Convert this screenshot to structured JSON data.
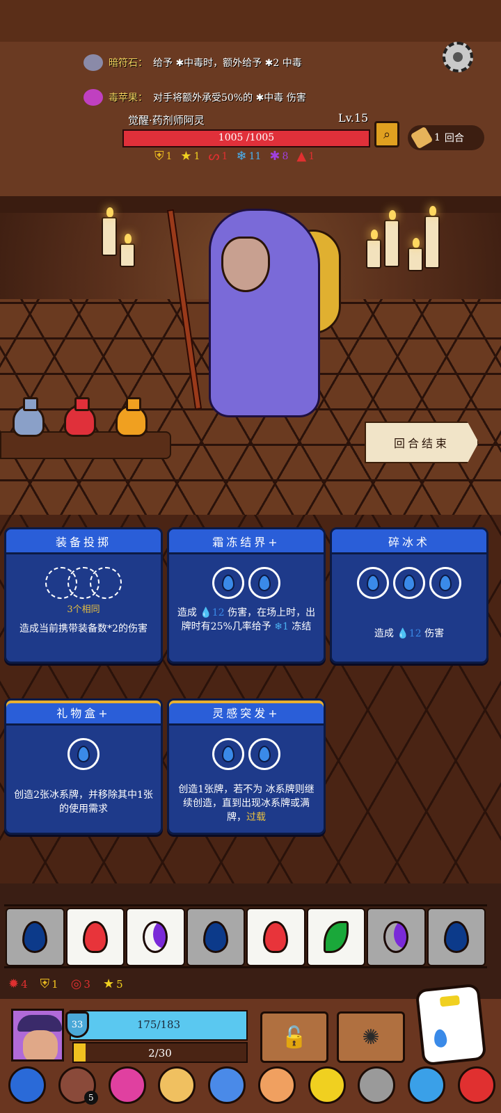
{
  "top_info": {
    "stone_name": "暗符石：",
    "stone_desc": "给予 ✱中毒时，额外给予 ✱2 中毒",
    "fruit_name": "毒苹果：",
    "fruit_desc": "对手将额外承受50%的 ✱中毒 伤害"
  },
  "enemy": {
    "name": "觉醒·药剂师阿灵",
    "level": "Lv.15",
    "hp_text": "1005 /1005",
    "hp_fraction": 1.0,
    "round_count": "1",
    "round_label": "回合",
    "statuses": [
      {
        "icon": "shield-icon",
        "glyph": "⛨",
        "color": "#f0c020",
        "value": "1"
      },
      {
        "icon": "star-icon",
        "glyph": "★",
        "color": "#f0d020",
        "value": "1"
      },
      {
        "icon": "curse-icon",
        "glyph": "ᔕ",
        "color": "#e03030",
        "value": "1"
      },
      {
        "icon": "frost-icon",
        "glyph": "❄",
        "color": "#4ab0f0",
        "value": "11"
      },
      {
        "icon": "poison-icon",
        "glyph": "✱",
        "color": "#a040e0",
        "value": "8"
      },
      {
        "icon": "flame-icon",
        "glyph": "▲",
        "color": "#e03030",
        "value": "1"
      }
    ]
  },
  "end_turn_label": "回合结束",
  "cards": [
    {
      "title": "装备投掷",
      "slot_note": "3个相同",
      "desc": "造成当前携带装备数*2的伤害"
    },
    {
      "title": "霜冻结界+",
      "desc_parts": [
        "造成 ",
        "12",
        " 伤害，在场上时，出牌时有25%几率给予 ",
        "❄1",
        " 冻结"
      ]
    },
    {
      "title": "碎冰术",
      "desc_parts": [
        "造成 ",
        "12",
        " 伤害"
      ]
    },
    {
      "title": "礼物盒+",
      "desc": "创造2张冰系牌，并移除其中1张的使用需求"
    },
    {
      "title": "灵感突发+",
      "desc_main": "创造1张牌，若不为 冰系牌则继续创造，直到出现冰系牌或满牌，",
      "desc_hl": "过载"
    }
  ],
  "dice_tray": [
    "water",
    "fire",
    "moon",
    "water",
    "fire",
    "leaf",
    "moon",
    "water"
  ],
  "player_statuses": [
    {
      "icon": "gear-burst-icon",
      "glyph": "✹",
      "color": "#e03030",
      "value": "4"
    },
    {
      "icon": "shield-icon",
      "glyph": "⛨",
      "color": "#f0c020",
      "value": "1"
    },
    {
      "icon": "spiral-icon",
      "glyph": "◎",
      "color": "#e03030",
      "value": "3"
    },
    {
      "icon": "star-icon",
      "glyph": "★",
      "color": "#f0d020",
      "value": "5"
    }
  ],
  "player": {
    "armor": "33",
    "hp_text": "175/183",
    "hp_fraction": 0.956,
    "exp_text": "2/30",
    "exp_fraction": 0.067
  },
  "relics": [
    {
      "name": "amulet-relic",
      "color": "#2a6ad8"
    },
    {
      "name": "button-relic",
      "color": "#8a4a3a",
      "count": "5"
    },
    {
      "name": "pink-blob-relic",
      "color": "#e040a0"
    },
    {
      "name": "cube-relic",
      "color": "#f0c060"
    },
    {
      "name": "blue-bird-relic",
      "color": "#4a8ae8"
    },
    {
      "name": "ring-relic",
      "color": "#f0a060"
    },
    {
      "name": "chain-relic",
      "color": "#f0d020"
    },
    {
      "name": "ghost-relic",
      "color": "#9a9a9a"
    },
    {
      "name": "crystal-relic",
      "color": "#3aa0e8"
    },
    {
      "name": "fire-relic",
      "color": "#e03030"
    }
  ]
}
